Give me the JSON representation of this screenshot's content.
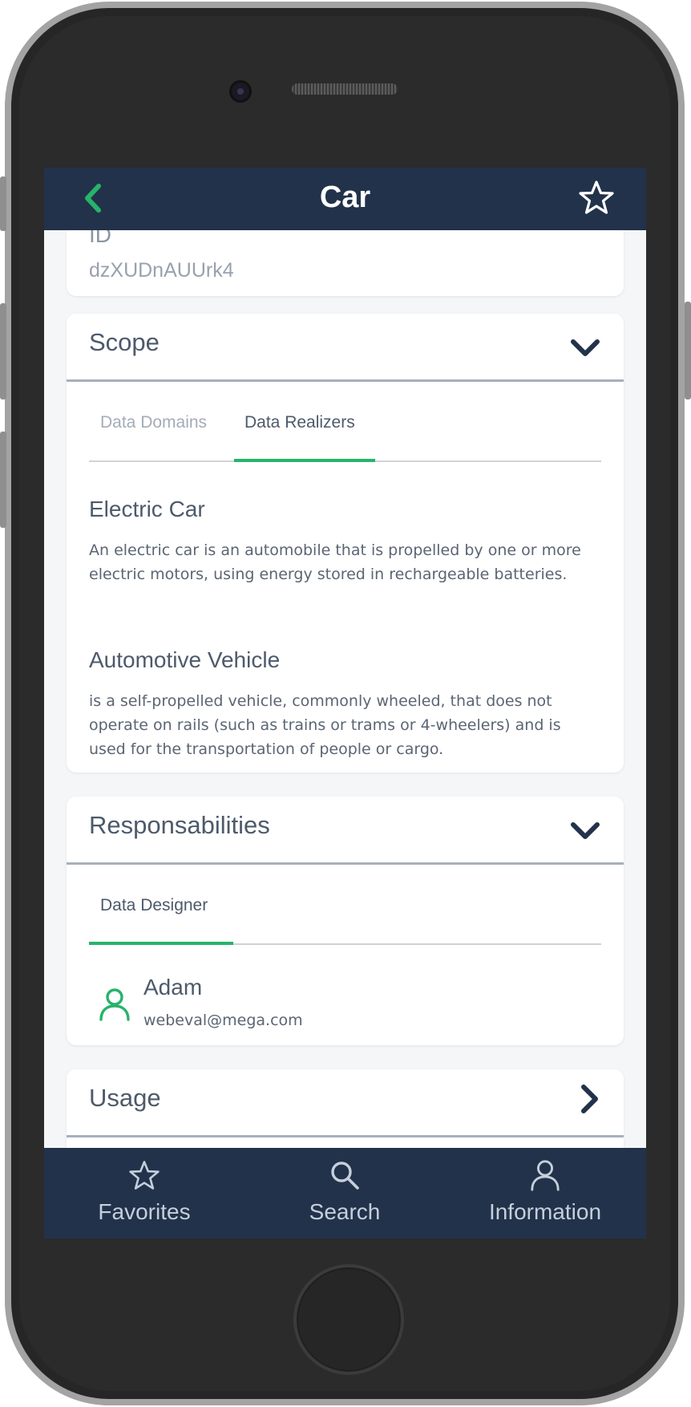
{
  "header": {
    "title": "Car"
  },
  "id_card": {
    "label": "ID",
    "value": "dzXUDnAUUrk4"
  },
  "scope": {
    "title": "Scope",
    "tabs": [
      {
        "label": "Data Domains"
      },
      {
        "label": "Data Realizers"
      }
    ],
    "items": [
      {
        "title": "Electric Car",
        "description": "An electric car is an automobile that is propelled by one or more electric motors, using energy stored in rechargeable batteries."
      },
      {
        "title": "Automotive Vehicle",
        "description": "is a self-propelled vehicle, commonly wheeled, that does not operate on rails (such as trains or trams or 4-wheelers) and is used for the transportation of people or cargo."
      }
    ]
  },
  "responsibilities": {
    "title": "Responsabilities",
    "tabs": [
      {
        "label": "Data Designer"
      }
    ],
    "person": {
      "name": "Adam",
      "email": "webeval@mega.com"
    }
  },
  "usage": {
    "title": "Usage"
  },
  "bottom_nav": [
    {
      "label": "Favorites",
      "icon": "star-icon"
    },
    {
      "label": "Search",
      "icon": "search-icon"
    },
    {
      "label": "Information",
      "icon": "user-icon"
    }
  ],
  "colors": {
    "navy": "#22324b",
    "accent": "#27b36a",
    "text": "#4d5a6b"
  }
}
